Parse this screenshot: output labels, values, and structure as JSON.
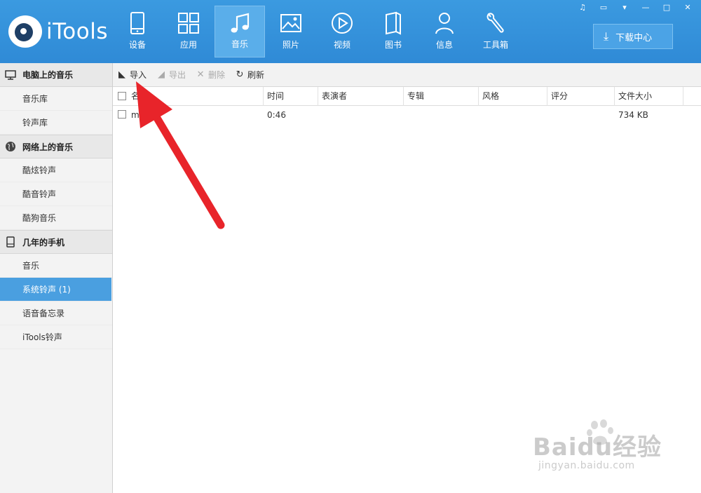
{
  "app": {
    "logo_text": "iTools"
  },
  "nav": [
    {
      "label": "设备",
      "icon": "phone-icon",
      "active": false
    },
    {
      "label": "应用",
      "icon": "apps-grid-icon",
      "active": false
    },
    {
      "label": "音乐",
      "icon": "music-note-icon",
      "active": true
    },
    {
      "label": "照片",
      "icon": "photo-icon",
      "active": false
    },
    {
      "label": "视频",
      "icon": "play-icon",
      "active": false
    },
    {
      "label": "图书",
      "icon": "book-icon",
      "active": false
    },
    {
      "label": "信息",
      "icon": "person-icon",
      "active": false
    },
    {
      "label": "工具箱",
      "icon": "wrench-icon",
      "active": false
    }
  ],
  "window_controls": [
    "music-mini-icon",
    "chat-icon",
    "dropdown-icon",
    "minimize-icon",
    "maximize-icon",
    "close-icon"
  ],
  "download_center": {
    "label": "下载中心",
    "icon": "download-icon"
  },
  "sidebar": {
    "sections": [
      {
        "title": "电脑上的音乐",
        "icon": "monitor-icon",
        "items": [
          {
            "label": "音乐库"
          },
          {
            "label": "铃声库"
          }
        ]
      },
      {
        "title": "网络上的音乐",
        "icon": "globe-icon",
        "items": [
          {
            "label": "酷炫铃声"
          },
          {
            "label": "酷音铃声"
          },
          {
            "label": "酷狗音乐"
          }
        ]
      },
      {
        "title": "几年的手机",
        "icon": "phone-small-icon",
        "items": [
          {
            "label": "音乐"
          },
          {
            "label": "系统铃声 (1)",
            "selected": true
          },
          {
            "label": "语音备忘录"
          },
          {
            "label": "iTools铃声"
          }
        ]
      }
    ]
  },
  "toolbar": {
    "import_label": "导入",
    "export_label": "导出",
    "delete_label": "删除",
    "refresh_label": "刷新"
  },
  "table": {
    "columns": [
      "名",
      "时间",
      "表演者",
      "专辑",
      "风格",
      "评分",
      "文件大小"
    ],
    "rows": [
      {
        "name": "me",
        "time": "0:46",
        "artist": "",
        "album": "",
        "genre": "",
        "rating": "",
        "size": "734 KB"
      }
    ]
  },
  "watermark": {
    "main": "Baidu经验",
    "sub": "jingyan.baidu.com"
  },
  "colors": {
    "header_blue": "#2f8ad6",
    "selected_blue": "#4a9fe0",
    "arrow_red": "#e8242a"
  }
}
